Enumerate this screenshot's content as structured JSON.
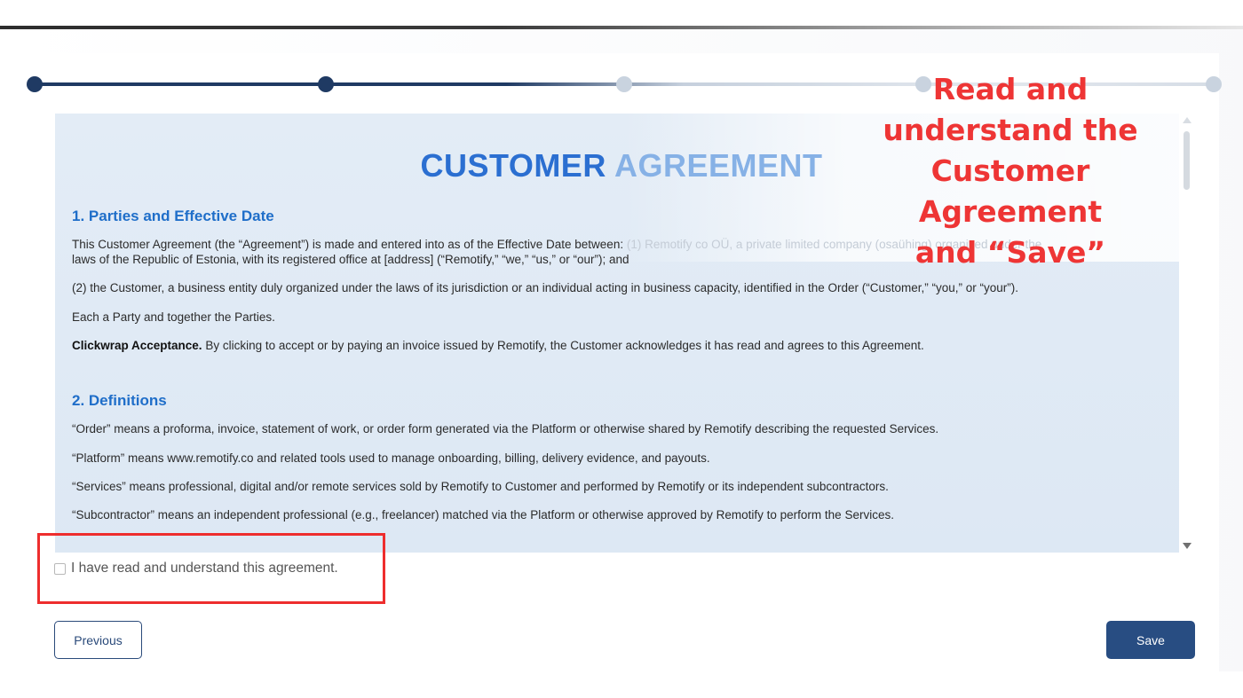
{
  "stepper": {
    "steps": [
      {
        "state": "completed"
      },
      {
        "state": "current"
      },
      {
        "state": "pending"
      },
      {
        "state": "pending"
      },
      {
        "state": "pending"
      }
    ]
  },
  "agreement": {
    "title_part1": "CUSTOMER",
    "title_part2": "AGREEMENT",
    "sections": [
      {
        "heading": "1. Parties and Effective Date",
        "paragraphs": [
          "This Customer Agreement (the “Agreement”) is made and entered into as of the Effective Date between: (1) Remotify co OÜ, a private limited company (osaühing) organized under the laws of the Republic of Estonia, with its registered office at [address] (“Remotify,” “we,” “us,” or “our”); and",
          "(2) the Customer, a business entity duly organized under the laws of its jurisdiction or an individual acting in business capacity, identified in the Order (“Customer,” “you,” or “your”).",
          "Each a Party and together the Parties."
        ],
        "clickwrap_bold": "Clickwrap Acceptance.",
        "clickwrap_text": " By clicking to accept or by paying an invoice issued by Remotify, the Customer acknowledges it has read and agrees to this Agreement."
      },
      {
        "heading": "2. Definitions",
        "paragraphs": [
          "“Order” means a proforma, invoice, statement of work, or order form generated via the Platform or otherwise shared by Remotify describing the requested Services.",
          "“Platform” means www.remotify.co and related tools used to manage onboarding, billing, delivery evidence, and payouts.",
          "“Services” means professional, digital and/or remote services sold by Remotify to Customer and performed by Remotify or its independent subcontractors.",
          "“Subcontractor” means an independent professional (e.g., freelancer) matched via the Platform or otherwise approved by Remotify to perform the Services."
        ]
      }
    ],
    "p1_visible": "This Customer Agreement (the “Agreement”) is made and entered into as of the Effective Date between: ",
    "p1_faded": "(1) Remotify co OÜ, a private limited company (osaühing) organized under the",
    "p1_line2": "laws of the Republic of Estonia, with its registered office at [address] (“Remotify,” “we,” “us,” or “our”); and"
  },
  "acknowledge": {
    "label": "I have read and understand this agreement.",
    "checked": false
  },
  "buttons": {
    "previous": "Previous",
    "save": "Save"
  },
  "annotation": {
    "lines": [
      "Read and",
      "understand the",
      "Customer Agreement",
      "and “Save”"
    ],
    "color": "#ee3535"
  },
  "colors": {
    "primary": "#284d82",
    "heading_blue": "#1f6ec9",
    "highlight_red": "#ee2d2d"
  }
}
